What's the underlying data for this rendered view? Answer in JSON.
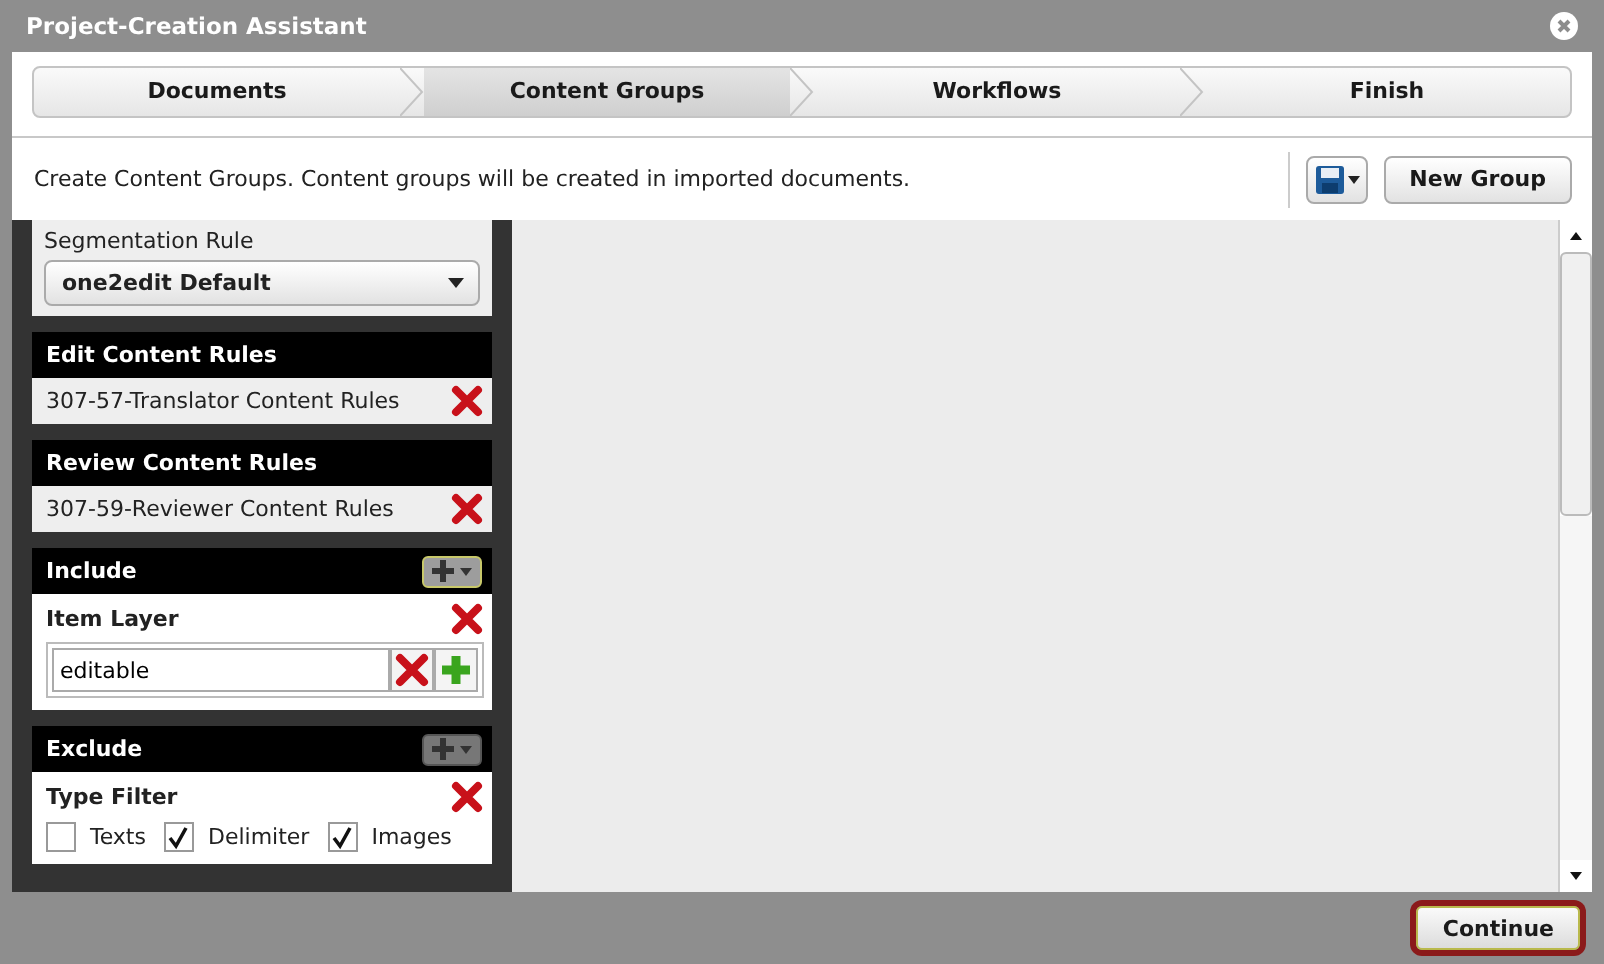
{
  "window": {
    "title": "Project-Creation Assistant"
  },
  "steps": [
    {
      "label": "Documents",
      "selected": false
    },
    {
      "label": "Content Groups",
      "selected": true
    },
    {
      "label": "Workflows",
      "selected": false
    },
    {
      "label": "Finish",
      "selected": false
    }
  ],
  "description": "Create Content Groups. Content groups will be created in imported documents.",
  "new_group_button": "New Group",
  "segmentation": {
    "label": "Segmentation Rule",
    "value": "one2edit Default"
  },
  "rule_sections": [
    {
      "title": "Edit Content Rules",
      "items": [
        "307-57-Translator Content Rules"
      ]
    },
    {
      "title": "Review Content Rules",
      "items": [
        "307-59-Reviewer Content Rules"
      ]
    }
  ],
  "filter_sections": [
    {
      "title": "Include",
      "add_highlighted": true,
      "filters": [
        {
          "kind": "text",
          "title": "Item Layer",
          "value": "editable"
        }
      ]
    },
    {
      "title": "Exclude",
      "add_highlighted": false,
      "filters": [
        {
          "kind": "checkboxes",
          "title": "Type Filter",
          "options": [
            {
              "label": "Texts",
              "checked": false
            },
            {
              "label": "Delimiter",
              "checked": true
            },
            {
              "label": "Images",
              "checked": true
            }
          ]
        }
      ]
    }
  ],
  "continue_button": {
    "label": "Continue",
    "focused": true
  }
}
